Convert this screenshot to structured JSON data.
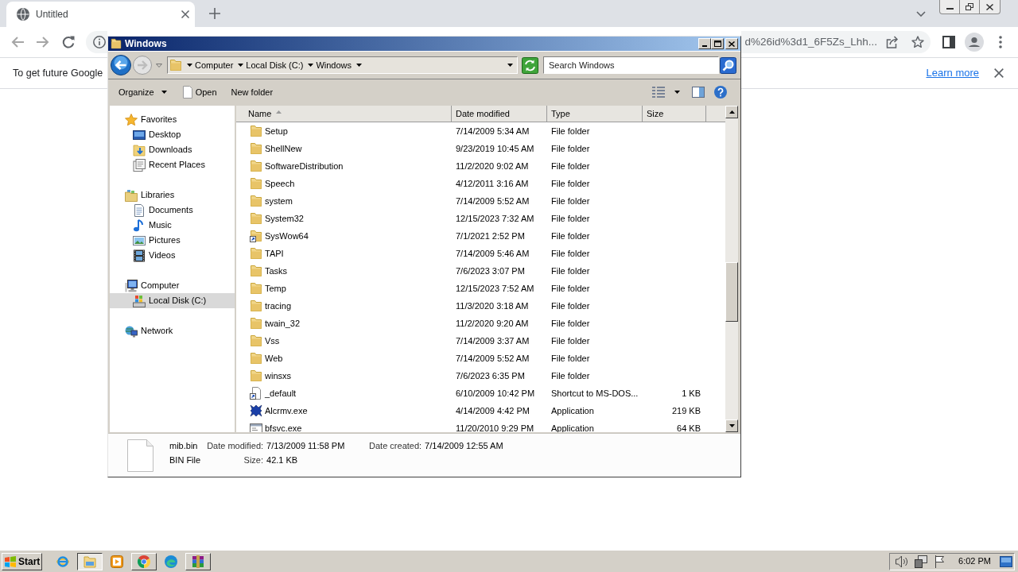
{
  "browser": {
    "tabs": [
      {
        "title": "Untitled",
        "selected": true
      }
    ],
    "address": "d%26id%3d1_6F5Zs_Lhh...",
    "infobar": {
      "message": "To get future Google",
      "link": "Learn more"
    }
  },
  "explorer": {
    "title": "Windows",
    "breadcrumbs": [
      "Computer",
      "Local Disk (C:)",
      "Windows"
    ],
    "search": {
      "placeholder": "Search Windows"
    },
    "commands": [
      {
        "label": "Organize",
        "kind": "menu"
      },
      {
        "label": "Open",
        "kind": "open"
      },
      {
        "label": "New folder",
        "kind": "plain"
      }
    ],
    "nav": [
      {
        "label": "Favorites",
        "kind": "favorites",
        "selected": false,
        "children": [
          {
            "label": "Desktop",
            "kind": "desktop",
            "selected": false
          },
          {
            "label": "Downloads",
            "kind": "downloads",
            "selected": false
          },
          {
            "label": "Recent Places",
            "kind": "recent",
            "selected": false
          }
        ]
      },
      {
        "label": "Libraries",
        "kind": "libraries",
        "selected": false,
        "children": [
          {
            "label": "Documents",
            "kind": "documents",
            "selected": false
          },
          {
            "label": "Music",
            "kind": "music",
            "selected": false
          },
          {
            "label": "Pictures",
            "kind": "pictures",
            "selected": false
          },
          {
            "label": "Videos",
            "kind": "videos",
            "selected": false
          }
        ]
      },
      {
        "label": "Computer",
        "kind": "computer",
        "selected": false,
        "children": [
          {
            "label": "Local Disk (C:)",
            "kind": "disk",
            "selected": true
          }
        ]
      },
      {
        "label": "Network",
        "kind": "network",
        "selected": false
      }
    ],
    "columns": [
      {
        "label": "Name",
        "sorted": true
      },
      {
        "label": "Date modified",
        "sorted": false
      },
      {
        "label": "Type",
        "sorted": false
      },
      {
        "label": "Size",
        "sorted": false
      }
    ],
    "rows": [
      {
        "name": "Setup",
        "date": "7/14/2009 5:34 AM",
        "type": "File folder",
        "kind": "folder"
      },
      {
        "name": "ShellNew",
        "date": "9/23/2019 10:45 AM",
        "type": "File folder",
        "kind": "folder"
      },
      {
        "name": "SoftwareDistribution",
        "date": "11/2/2020 9:02 AM",
        "type": "File folder",
        "kind": "folder"
      },
      {
        "name": "Speech",
        "date": "4/12/2011 3:16 AM",
        "type": "File folder",
        "kind": "folder"
      },
      {
        "name": "system",
        "date": "7/14/2009 5:52 AM",
        "type": "File folder",
        "kind": "folder"
      },
      {
        "name": "System32",
        "date": "12/15/2023 7:32 AM",
        "type": "File folder",
        "kind": "folder"
      },
      {
        "name": "SysWow64",
        "date": "7/1/2021 2:52 PM",
        "type": "File folder",
        "kind": "folder_shortcut"
      },
      {
        "name": "TAPI",
        "date": "7/14/2009 5:46 AM",
        "type": "File folder",
        "kind": "folder"
      },
      {
        "name": "Tasks",
        "date": "7/6/2023 3:07 PM",
        "type": "File folder",
        "kind": "folder"
      },
      {
        "name": "Temp",
        "date": "12/15/2023 7:52 AM",
        "type": "File folder",
        "kind": "folder"
      },
      {
        "name": "tracing",
        "date": "11/3/2020 3:18 AM",
        "type": "File folder",
        "kind": "folder"
      },
      {
        "name": "twain_32",
        "date": "11/2/2020 9:20 AM",
        "type": "File folder",
        "kind": "folder"
      },
      {
        "name": "Vss",
        "date": "7/14/2009 3:37 AM",
        "type": "File folder",
        "kind": "folder"
      },
      {
        "name": "Web",
        "date": "7/14/2009 5:52 AM",
        "type": "File folder",
        "kind": "folder"
      },
      {
        "name": "winsxs",
        "date": "7/6/2023 6:35 PM",
        "type": "File folder",
        "kind": "folder"
      },
      {
        "name": "_default",
        "date": "6/10/2009 10:42 PM",
        "type": "Shortcut to MS-DOS...",
        "size": "1 KB",
        "kind": "shortcut"
      },
      {
        "name": "Alcrmv.exe",
        "date": "4/14/2009 4:42 PM",
        "type": "Application",
        "size": "219 KB",
        "kind": "app_emblem"
      },
      {
        "name": "bfsvc.exe",
        "date": "11/20/2010 9:29 PM",
        "type": "Application",
        "size": "64 KB",
        "kind": "app_window"
      }
    ],
    "details": {
      "name": "mib.bin",
      "type": "BIN File",
      "fields": [
        {
          "label": "Date modified:",
          "value": "7/13/2009 11:58 PM"
        },
        {
          "label": "Date created:",
          "value": "7/14/2009 12:55 AM"
        },
        {
          "label": "Size:",
          "value": "42.1 KB"
        }
      ]
    }
  },
  "taskbar": {
    "start": "Start",
    "apps": [
      {
        "kind": "e_logo",
        "running": false,
        "selected": false
      },
      {
        "kind": "folder",
        "running": true,
        "selected": true
      },
      {
        "kind": "player",
        "running": false,
        "selected": false
      },
      {
        "kind": "ball",
        "running": true,
        "selected": false
      },
      {
        "kind": "wave",
        "running": false,
        "selected": false
      },
      {
        "kind": "books",
        "running": true,
        "selected": false
      }
    ],
    "clock": "6:02 PM"
  }
}
